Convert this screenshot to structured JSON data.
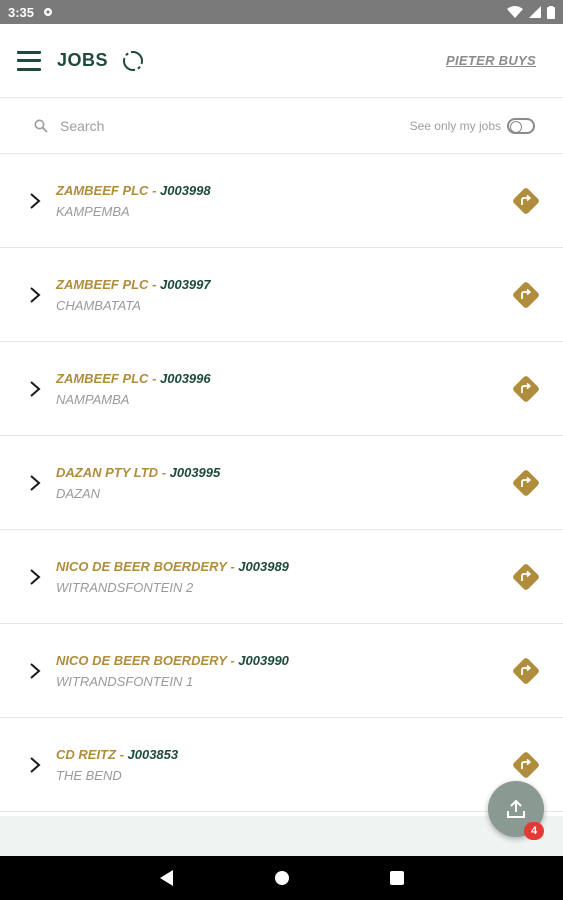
{
  "status": {
    "time": "3:35"
  },
  "header": {
    "title": "JOBS",
    "user": "PIETER BUYS"
  },
  "search": {
    "placeholder": "Search",
    "toggle_label": "See only my jobs",
    "toggle_on": false
  },
  "jobs": [
    {
      "client": "ZAMBEEF PLC",
      "job": "J003998",
      "site": "KAMPEMBA"
    },
    {
      "client": "ZAMBEEF PLC",
      "job": "J003997",
      "site": "CHAMBATATA"
    },
    {
      "client": "ZAMBEEF PLC",
      "job": "J003996",
      "site": "NAMPAMBA"
    },
    {
      "client": "DAZAN PTY LTD",
      "job": "J003995",
      "site": "DAZAN"
    },
    {
      "client": "NICO DE BEER BOERDERY",
      "job": "J003989",
      "site": "WITRANDSFONTEIN 2"
    },
    {
      "client": "NICO DE BEER BOERDERY",
      "job": "J003990",
      "site": "WITRANDSFONTEIN 1"
    },
    {
      "client": "CD REITZ",
      "job": "J003853",
      "site": "THE BEND"
    }
  ],
  "upload": {
    "badge": "4"
  },
  "colors": {
    "primary": "#1d4a3a",
    "accent": "#b08d3c",
    "fab": "#8a9a93",
    "badge": "#e53935"
  }
}
